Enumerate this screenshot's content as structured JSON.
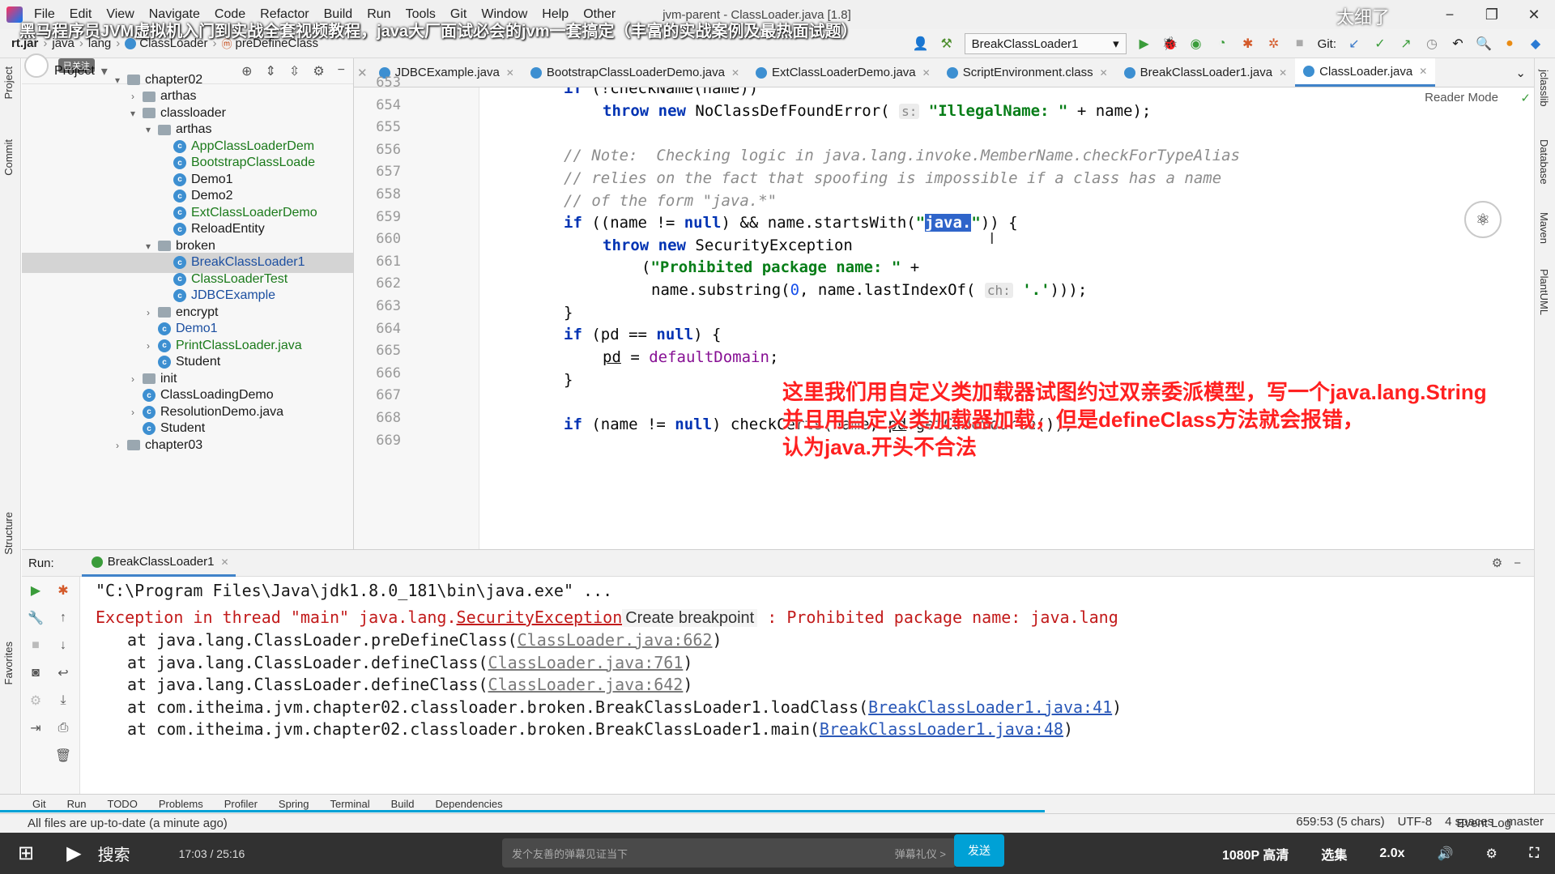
{
  "menubar": {
    "items": [
      "File",
      "Edit",
      "View",
      "Navigate",
      "Code",
      "Refactor",
      "Build",
      "Run",
      "Tools",
      "Git",
      "Window",
      "Help",
      "Other"
    ],
    "window_title": "jvm-parent - ClassLoader.java [1.8]"
  },
  "overlay": {
    "video_title": "黑马程序员JVM虚拟机入门到实战全套视频教程，java大厂面试必会的jvm一套搞定（丰富的实战案例及最热面试题）",
    "corner_text": "太细了",
    "follow_badge": "已关注"
  },
  "breadcrumb": [
    "rt.jar",
    "java",
    "lang",
    "ClassLoader",
    "preDefineClass"
  ],
  "toolbar": {
    "run_config": "BreakClassLoader1",
    "git_label": "Git:"
  },
  "left_strip": {
    "project": "Project",
    "commit": "Commit",
    "structure": "Structure",
    "favorites": "Favorites"
  },
  "right_strip": {
    "jclasslib": "jclasslib",
    "database": "Database",
    "maven": "Maven",
    "plantuml": "PlantUML"
  },
  "project_panel": {
    "title": "Project",
    "tree": [
      {
        "label": "chapter02",
        "type": "folder",
        "depth": 0,
        "arrow": "▾"
      },
      {
        "label": "arthas",
        "type": "folder",
        "depth": 1,
        "arrow": "›"
      },
      {
        "label": "classloader",
        "type": "folder",
        "depth": 1,
        "arrow": "▾"
      },
      {
        "label": "arthas",
        "type": "folder",
        "depth": 2,
        "arrow": "▾"
      },
      {
        "label": "AppClassLoaderDem",
        "type": "class-green",
        "depth": 3,
        "arrow": ""
      },
      {
        "label": "BootstrapClassLoade",
        "type": "class-green",
        "depth": 3,
        "arrow": ""
      },
      {
        "label": "Demo1",
        "type": "class",
        "depth": 3,
        "arrow": ""
      },
      {
        "label": "Demo2",
        "type": "class",
        "depth": 3,
        "arrow": ""
      },
      {
        "label": "ExtClassLoaderDemo",
        "type": "class-green",
        "depth": 3,
        "arrow": ""
      },
      {
        "label": "ReloadEntity",
        "type": "class",
        "depth": 3,
        "arrow": ""
      },
      {
        "label": "broken",
        "type": "folder",
        "depth": 2,
        "arrow": "▾"
      },
      {
        "label": "BreakClassLoader1",
        "type": "class-blue",
        "depth": 3,
        "arrow": "",
        "selected": true
      },
      {
        "label": "ClassLoaderTest",
        "type": "class-green",
        "depth": 3,
        "arrow": ""
      },
      {
        "label": "JDBCExample",
        "type": "class-blue",
        "depth": 3,
        "arrow": ""
      },
      {
        "label": "encrypt",
        "type": "folder",
        "depth": 2,
        "arrow": "›"
      },
      {
        "label": "Demo1",
        "type": "class-blue",
        "depth": 2,
        "arrow": ""
      },
      {
        "label": "PrintClassLoader.java",
        "type": "class-green",
        "depth": 2,
        "arrow": "›"
      },
      {
        "label": "Student",
        "type": "class",
        "depth": 2,
        "arrow": ""
      },
      {
        "label": "init",
        "type": "folder",
        "depth": 1,
        "arrow": "›"
      },
      {
        "label": "ClassLoadingDemo",
        "type": "class",
        "depth": 1,
        "arrow": ""
      },
      {
        "label": "ResolutionDemo.java",
        "type": "class",
        "depth": 1,
        "arrow": "›"
      },
      {
        "label": "Student",
        "type": "class",
        "depth": 1,
        "arrow": ""
      },
      {
        "label": "chapter03",
        "type": "folder",
        "depth": 0,
        "arrow": "›"
      }
    ]
  },
  "editor_tabs": [
    {
      "label": "JDBCExample.java",
      "active": false
    },
    {
      "label": "BootstrapClassLoaderDemo.java",
      "active": false
    },
    {
      "label": "ExtClassLoaderDemo.java",
      "active": false
    },
    {
      "label": "ScriptEnvironment.class",
      "active": false
    },
    {
      "label": "BreakClassLoader1.java",
      "active": false
    },
    {
      "label": "ClassLoader.java",
      "active": true
    }
  ],
  "editor": {
    "reader_mode": "Reader Mode",
    "line_numbers": [
      "653",
      "654",
      "655",
      "656",
      "657",
      "658",
      "659",
      "660",
      "661",
      "662",
      "663",
      "664",
      "665",
      "666",
      "667",
      "668",
      "669"
    ]
  },
  "annotation": {
    "line1": "这里我们用自定义类加载器试图约过双亲委派模型，写一个java.lang.String",
    "line2": "并且用自定义类加载器加载，但是defineClass方法就会报错，",
    "line3": "认为java.开头不合法"
  },
  "run_panel": {
    "label": "Run:",
    "tab": "BreakClassLoader1",
    "console": {
      "cmd": "\"C:\\Program Files\\Java\\jdk1.8.0_181\\bin\\java.exe\" ...",
      "exc_prefix": "Exception in thread \"main\" java.lang.",
      "exc_class": "SecurityException",
      "tooltip": "Create breakpoint",
      "exc_msg": " : Prohibited package name: java.lang",
      "frames": [
        {
          "text": "at java.lang.ClassLoader.preDefineClass(",
          "link": "ClassLoader.java:662",
          "grey": true
        },
        {
          "text": "at java.lang.ClassLoader.defineClass(",
          "link": "ClassLoader.java:761",
          "grey": true
        },
        {
          "text": "at java.lang.ClassLoader.defineClass(",
          "link": "ClassLoader.java:642",
          "grey": true
        },
        {
          "text": "at com.itheima.jvm.chapter02.classloader.broken.BreakClassLoader1.loadClass(",
          "link": "BreakClassLoader1.java:41",
          "grey": false
        },
        {
          "text": "at com.itheima.jvm.chapter02.classloader.broken.BreakClassLoader1.main(",
          "link": "BreakClassLoader1.java:48",
          "grey": false
        }
      ]
    }
  },
  "bottom_tabs": [
    "Git",
    "Run",
    "TODO",
    "Problems",
    "Profiler",
    "Spring",
    "Terminal",
    "Build",
    "Dependencies"
  ],
  "status": {
    "message": "All files are up-to-date (a minute ago)",
    "position": "659:53 (5 chars)",
    "encoding": "UTF-8",
    "indent": "4 spaces",
    "branch": "master",
    "event_log": "Event Log"
  },
  "player": {
    "search_label": "搜索",
    "time": "17:03 / 25:16",
    "danmaku_placeholder": "发个友善的弹幕见证当下",
    "danmaku_etiquette": "弹幕礼仪 >",
    "send": "发送",
    "quality": "1080P 高清",
    "episodes": "选集",
    "speed": "2.0x"
  }
}
